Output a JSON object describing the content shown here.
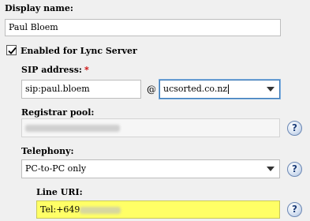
{
  "display_name": {
    "label": "Display name:",
    "value": "Paul Bloem"
  },
  "enabled": {
    "label": "Enabled for Lync Server",
    "checked": true
  },
  "sip": {
    "label": "SIP address:",
    "required_mark": "*",
    "user_value": "sip:paul.bloem",
    "at": "@",
    "domain_value": "ucsorted.co.nz"
  },
  "registrar": {
    "label": "Registrar pool:"
  },
  "telephony": {
    "label": "Telephony:",
    "value": "PC-to-PC only"
  },
  "line_uri": {
    "label": "Line URI:",
    "value_prefix": "Tel:+649"
  },
  "help": {
    "glyph": "?"
  }
}
